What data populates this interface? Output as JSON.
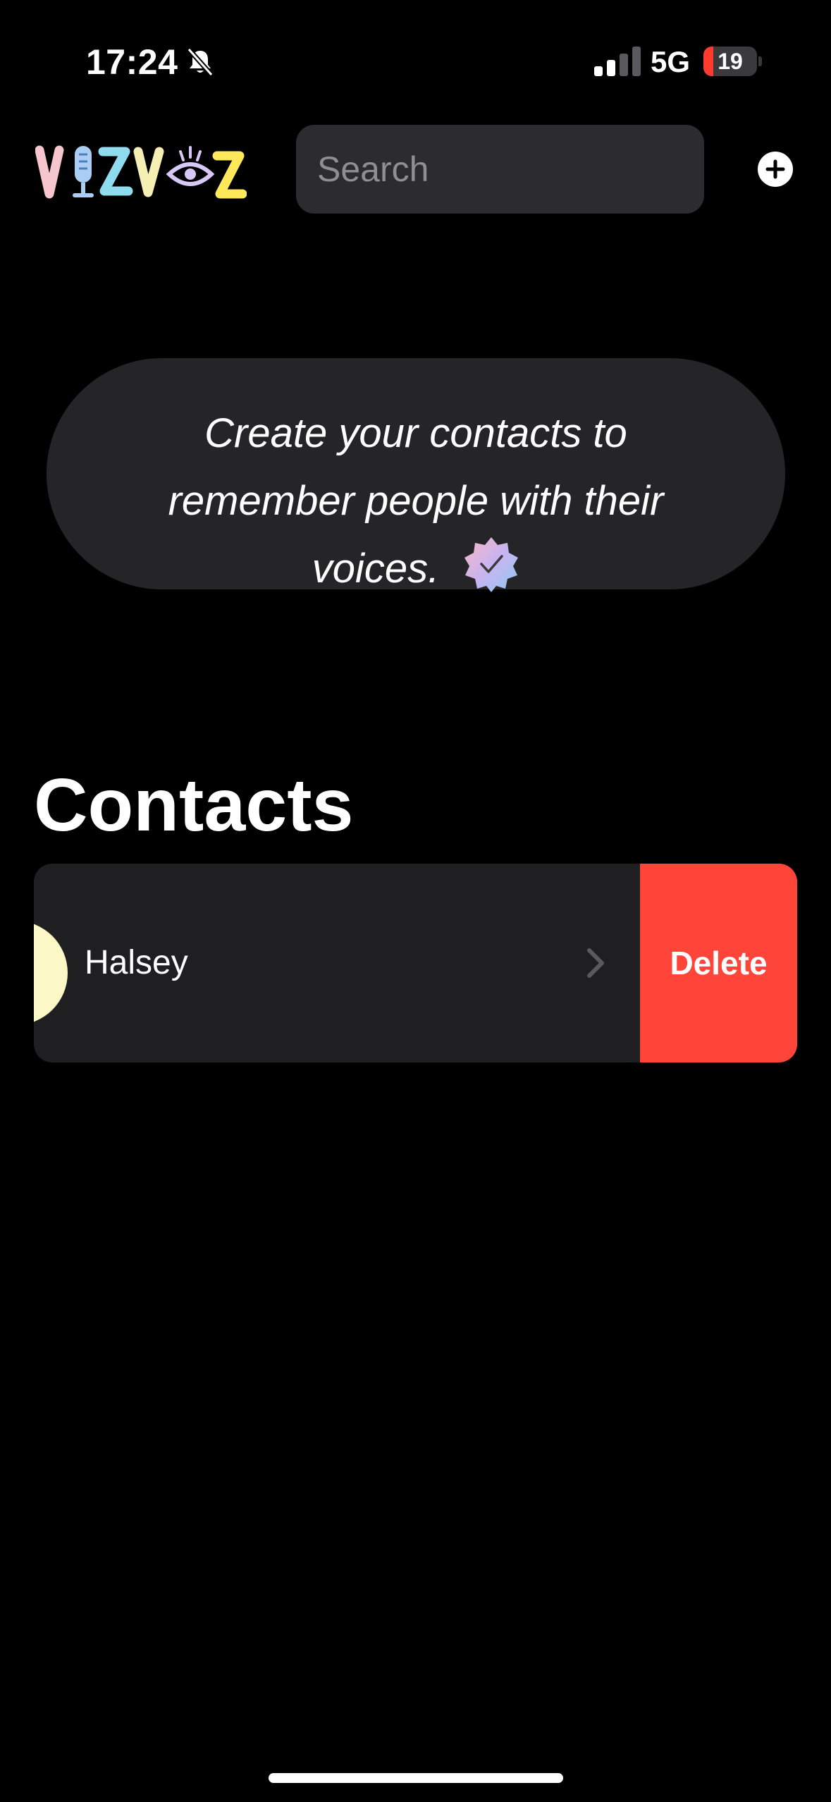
{
  "status_bar": {
    "time": "17:24",
    "network": "5G",
    "battery_level": "19",
    "battery_fraction": 0.19,
    "icons": {
      "silent": "bell-slash-icon",
      "signal": "cellular-signal-icon",
      "battery": "battery-icon"
    }
  },
  "header": {
    "logo_text": "VIZVOZ",
    "search": {
      "placeholder": "Search",
      "value": ""
    },
    "add_icon": "plus-circle-icon"
  },
  "info_card": {
    "text": "Create your contacts to remember people with their voices.",
    "icon": "verified-badge-icon"
  },
  "contacts": {
    "title": "Contacts",
    "items": [
      {
        "name": "Halsey",
        "action_label": "Delete",
        "avatar_color": "#fbf7c7",
        "chevron_icon": "chevron-right-icon"
      }
    ]
  },
  "colors": {
    "background": "#000000",
    "card": "#252528",
    "row": "#1f1f21",
    "search_bg": "#2c2c2e",
    "delete": "#ff453a",
    "battery_low": "#ff3b30"
  }
}
